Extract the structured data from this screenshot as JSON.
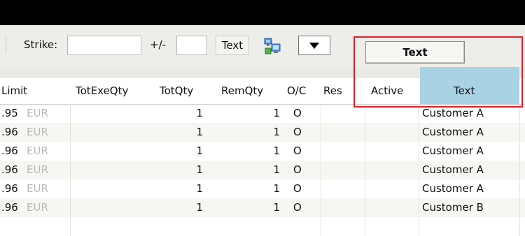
{
  "toolbar": {
    "strike_label": "Strike:",
    "strike_value": "",
    "plusminus_label": "+/-",
    "plusminus_value": "",
    "text_button": "Text",
    "highlight_button": "Text"
  },
  "icons": {
    "network": "network-computer-icon",
    "dropdown": "dropdown-arrow-icon"
  },
  "colors": {
    "highlight_border": "#e0202a",
    "selected_header": "#a9d3e5"
  },
  "table": {
    "headers": {
      "limit": "Limit",
      "totexeqty": "TotExeQty",
      "totqty": "TotQty",
      "remqty": "RemQty",
      "oc": "O/C",
      "res": "Res",
      "active": "Active",
      "text": "Text"
    },
    "rows": [
      {
        "limit": ".95",
        "currency": "EUR",
        "totexeqty": "",
        "totqty": "1",
        "remqty": "1",
        "oc": "O",
        "res": "",
        "active": "",
        "text": "Customer A"
      },
      {
        "limit": ".96",
        "currency": "EUR",
        "totexeqty": "",
        "totqty": "1",
        "remqty": "1",
        "oc": "O",
        "res": "",
        "active": "",
        "text": "Customer A"
      },
      {
        "limit": ".96",
        "currency": "EUR",
        "totexeqty": "",
        "totqty": "1",
        "remqty": "1",
        "oc": "O",
        "res": "",
        "active": "",
        "text": "Customer A"
      },
      {
        "limit": ".96",
        "currency": "EUR",
        "totexeqty": "",
        "totqty": "1",
        "remqty": "1",
        "oc": "O",
        "res": "",
        "active": "",
        "text": "Customer A"
      },
      {
        "limit": ".96",
        "currency": "EUR",
        "totexeqty": "",
        "totqty": "1",
        "remqty": "1",
        "oc": "O",
        "res": "",
        "active": "",
        "text": "Customer A"
      },
      {
        "limit": ".96",
        "currency": "EUR",
        "totexeqty": "",
        "totqty": "1",
        "remqty": "1",
        "oc": "O",
        "res": "",
        "active": "",
        "text": "Customer B"
      }
    ]
  }
}
